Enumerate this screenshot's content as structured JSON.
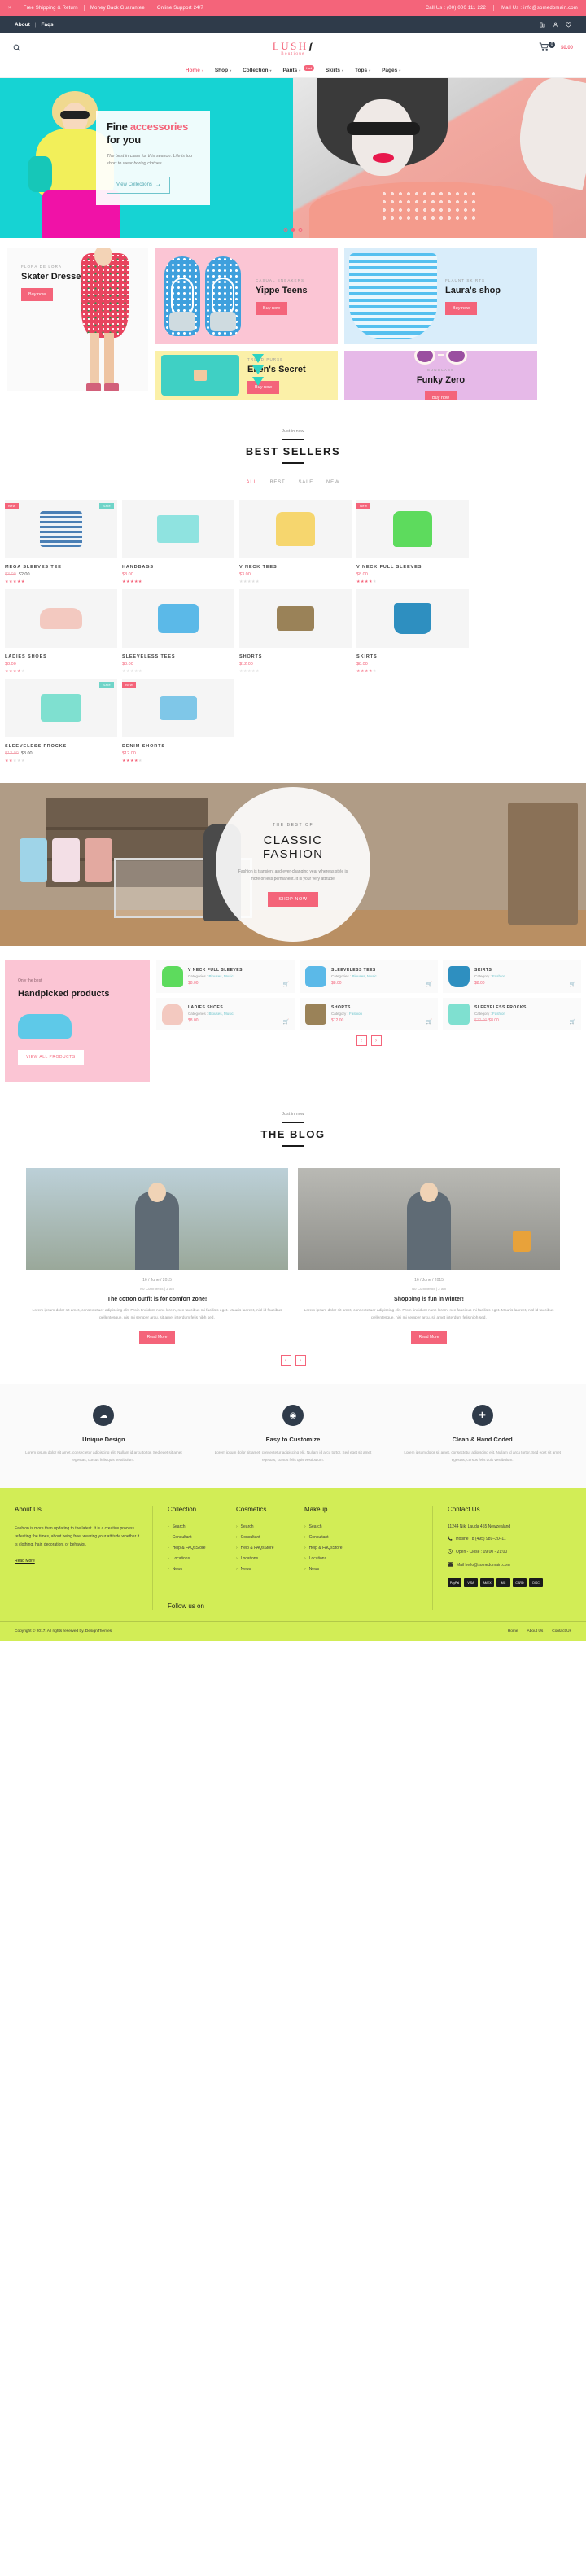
{
  "topbar": {
    "close": "×",
    "items": [
      "Free Shipping & Return",
      "Money Back Guarantee",
      "Online Support 24/7"
    ],
    "call": "Call Us : (00) 000 111 222",
    "mail": "Mail Us : info@somedomain.com"
  },
  "subbar": {
    "about": "About",
    "sep": "|",
    "faqs": "Faqs",
    "icons": [
      "compare-icon",
      "user-icon",
      "wishlist-icon"
    ]
  },
  "header": {
    "search_icon": "search-icon",
    "logo_main": "LUSH",
    "logo_mark": "ƒ",
    "logo_sub": "Boutique",
    "cart_icon": "cart-icon",
    "cart_count": "0",
    "cart_total": "$0.00"
  },
  "nav": {
    "items": [
      {
        "label": "Home",
        "caret": "▾",
        "active": true,
        "badge": ""
      },
      {
        "label": "Shop",
        "caret": "▾",
        "active": false,
        "badge": ""
      },
      {
        "label": "Collection",
        "caret": "▾",
        "active": false,
        "badge": ""
      },
      {
        "label": "Pants",
        "caret": "▾",
        "active": false,
        "badge": "Hot"
      },
      {
        "label": "Skirts",
        "caret": "▾",
        "active": false,
        "badge": ""
      },
      {
        "label": "Tops",
        "caret": "▾",
        "active": false,
        "badge": ""
      },
      {
        "label": "Pages",
        "caret": "▾",
        "active": false,
        "badge": ""
      }
    ]
  },
  "hero": {
    "title_1": "Fine ",
    "title_hl": "accessories",
    "title_2": "for you",
    "desc": "The best in class for this season. Life is too short to wear boring clothes.",
    "cta": "View Collections",
    "cta_arrow": "➝",
    "dots": 3,
    "active_dot": 1
  },
  "tiles": [
    {
      "label": "FLORA DE LORA",
      "title": "Skater Dresses",
      "cta": "Buy now"
    },
    {
      "label": "CASUAL SNEAKERS",
      "title": "Yippe Teens",
      "cta": "Buy now"
    },
    {
      "label": "FLAUNT SKIRTS",
      "title": "Laura's shop",
      "cta": "Buy now"
    },
    {
      "label": "TREND PURSE",
      "title": "Ellen's Secret",
      "cta": "Buy now"
    },
    {
      "label": "SUNGLASS",
      "title": "Funky Zero",
      "cta": "Buy now"
    }
  ],
  "bestsellers": {
    "kicker": "Just in now",
    "title": "BEST SELLERS",
    "filters": [
      "ALL",
      "BEST",
      "SALE",
      "NEW"
    ],
    "active_filter": "ALL",
    "products": [
      {
        "name": "MEGA SLEEVES TEE",
        "old_price": "$3.00",
        "price": "$2.00",
        "stars": 5,
        "tag": "New",
        "tag2": "Sale",
        "shape": "sh-stripe"
      },
      {
        "name": "HANDBAGS",
        "old_price": "",
        "price": "$8.00",
        "stars": 5,
        "tag": "",
        "tag2": "",
        "shape": "sh-bag"
      },
      {
        "name": "V NECK TEES",
        "old_price": "",
        "price": "$3.00",
        "stars": 0,
        "tag": "",
        "tag2": "",
        "shape": "sh-tee"
      },
      {
        "name": "V NECK FULL SLEEVES",
        "old_price": "",
        "price": "$8.00",
        "stars": 4,
        "tag": "New",
        "tag2": "",
        "shape": "sh-green"
      },
      {
        "name": "LADIES SHOES",
        "old_price": "",
        "price": "$8.00",
        "stars": 4,
        "tag": "",
        "tag2": "",
        "shape": "sh-shoe"
      },
      {
        "name": "SLEEVELESS TEES",
        "old_price": "",
        "price": "$8.00",
        "stars": 0,
        "tag": "",
        "tag2": "",
        "shape": "sh-blue"
      },
      {
        "name": "SHORTS",
        "old_price": "",
        "price": "$12.00",
        "stars": 0,
        "tag": "",
        "tag2": "",
        "shape": "sh-khaki"
      },
      {
        "name": "SKIRTS",
        "old_price": "",
        "price": "$8.00",
        "stars": 4,
        "tag": "",
        "tag2": "",
        "shape": "sh-skirt"
      },
      {
        "name": "SLEEVELESS FROCKS",
        "old_price": "$12.00",
        "price": "$8.00",
        "stars": 2,
        "tag": "",
        "tag2": "Sale",
        "shape": "sh-frock"
      },
      {
        "name": "DENIM SHORTS",
        "old_price": "",
        "price": "$12.00",
        "stars": 4,
        "tag": "New",
        "tag2": "",
        "shape": "sh-denim"
      }
    ]
  },
  "banner": {
    "kicker": "THE BEST OF",
    "title": "CLASSIC FASHION",
    "text": "Fashion is transient and ever-changing year whereas style is more or less permanent. It is your very attitude!",
    "cta": "SHOP NOW"
  },
  "handpicked": {
    "kicker": "Only the best",
    "title": "Handpicked products",
    "cta": "VIEW ALL PRODUCTS",
    "cart_icon": "cart-icon",
    "prev": "‹",
    "next": "›",
    "items": [
      {
        "name": "V NECK FULL SLEEVES",
        "cat_label": "Categories :",
        "cat": "Blouses, Music",
        "old_price": "",
        "price": "$8.00",
        "shape": "sh-green"
      },
      {
        "name": "SLEEVELESS TEES",
        "cat_label": "Categories :",
        "cat": "Blouses, Music",
        "old_price": "",
        "price": "$8.00",
        "shape": "sh-blue"
      },
      {
        "name": "SKIRTS",
        "cat_label": "Category :",
        "cat": "Fashion",
        "old_price": "",
        "price": "$8.00",
        "shape": "sh-skirt"
      },
      {
        "name": "LADIES SHOES",
        "cat_label": "Categories :",
        "cat": "Blouses, Music",
        "old_price": "",
        "price": "$8.00",
        "shape": "sh-shoe"
      },
      {
        "name": "SHORTS",
        "cat_label": "Category :",
        "cat": "Fashion",
        "old_price": "",
        "price": "$12.00",
        "shape": "sh-khaki"
      },
      {
        "name": "SLEEVELESS FROCKS",
        "cat_label": "Category :",
        "cat": "Fashion",
        "old_price": "$12.00",
        "price": "$8.00",
        "shape": "sh-frock"
      }
    ]
  },
  "blog": {
    "kicker": "Just in now",
    "title": "THE BLOG",
    "prev": "‹",
    "next": "›",
    "posts": [
      {
        "date": "16 / June / 2015",
        "comments": "No Comments | 2 am",
        "title": "The cotton outfit is for comfort zone!",
        "text": "Lorem ipsum dolor sit amet, consectetuer adipiscing elit. Proin tincidunt nunc lorem, nec faucibus mi facilisis eget. Mauris laoreet, nisl id faucibus pellentesque, nisi mi semper arcu, sit amet interdum felis nibh sed.",
        "cta": "Read More"
      },
      {
        "date": "16 / June / 2015",
        "comments": "No Comments | 2 am",
        "title": "Shopping is fun in winter!",
        "text": "Lorem ipsum dolor sit amet, consectetuer adipiscing elit. Proin tincidunt nunc lorem, nec faucibus mi facilisis eget. Mauris laoreet, nisl id faucibus pellentesque, nisi mi semper arcu, sit amet interdum felis nibh sed.",
        "cta": "Read More"
      }
    ]
  },
  "features": [
    {
      "icon": "cloud-icon",
      "glyph": "☁",
      "title": "Unique Design",
      "text": "Lorem ipsum dolor sit amet, consectetur adipiscing elit. Nullam id arcu tortor. Sed eget sit amet egestas, cursus felis quis vestibulum."
    },
    {
      "icon": "eye-icon",
      "glyph": "◉",
      "title": "Easy to Customize",
      "text": "Lorem ipsum dolor sit amet, consectetur adipiscing elit. Nullam id arcu tortor. Sed eget sit amet egestas, cursus felis quis vestibulum."
    },
    {
      "icon": "plus-icon",
      "glyph": "✚",
      "title": "Clean & Hand Coded",
      "text": "Lorem ipsum dolor sit amet, consectetur adipiscing elit. Nullam id arcu tortor. Sed eget sit amet egestas, cursus felis quis vestibulum."
    }
  ],
  "footer": {
    "about_title": "About Us",
    "about_text": "Fashion is more than updating to the latest. It is a creative process reflecting the times, about being free, wearing your attitude whether it is clothing, hair, decoration, or behavior.",
    "read_more": "Read More",
    "columns": [
      {
        "title": "Collection",
        "links": [
          "Search",
          "Consultant",
          "Help & FAQsStore",
          "Locations",
          "News"
        ]
      },
      {
        "title": "Cosmetics",
        "links": [
          "Search",
          "Consultant",
          "Help & FAQsStore",
          "Locations",
          "News"
        ]
      },
      {
        "title": "Makeup",
        "links": [
          "Search",
          "Consultant",
          "Help & FAQsStore",
          "Locations",
          "News"
        ]
      }
    ],
    "follow": "Follow us on",
    "contact_title": "Contact Us",
    "address": "11244 Niki Lauda 455 Newzealand",
    "hotline": "Hotline : 8 (495) 989–20–11",
    "hours": "Open - Close : 09:00 - 21:00",
    "mail": "Mail hello@somedomain.com",
    "hotline_icon": "phone-icon",
    "hours_icon": "clock-icon",
    "mail_icon": "envelope-icon",
    "payments": [
      "PayPal",
      "VISA",
      "AMEX",
      "MC",
      "CARD",
      "DISC"
    ],
    "copyright": "Copyright © 2017. All rights reserved by. DesignThemes",
    "bottom_links": [
      "Home",
      "About Us",
      "Contact Us"
    ]
  },
  "colors": {
    "accent": "#f4647a",
    "dark": "#2f3b4a",
    "teal": "#16d3d3",
    "footer": "#d2ed56"
  }
}
